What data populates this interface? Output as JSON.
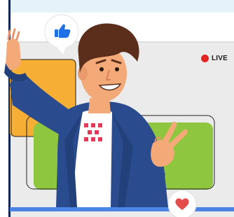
{
  "stream_card": {
    "live_label": "LIVE"
  },
  "reactions": {
    "like_icon": "thumbs-up-icon",
    "heart_icon": "heart-icon"
  },
  "colors": {
    "frame_border": "#0e2451",
    "top_band": "#e6f2f9",
    "window_gray": "#ebebeb",
    "orange_panel": "#f7ae35",
    "green_panel": "#8ec63f",
    "bottom_bar": "#4a85e6",
    "live_red": "#e5251f",
    "like_blue": "#1f6fe6",
    "heart_red": "#e54b4b",
    "jacket": "#2a4b8d",
    "hair": "#5a2e1b",
    "skin": "#f3a978"
  }
}
